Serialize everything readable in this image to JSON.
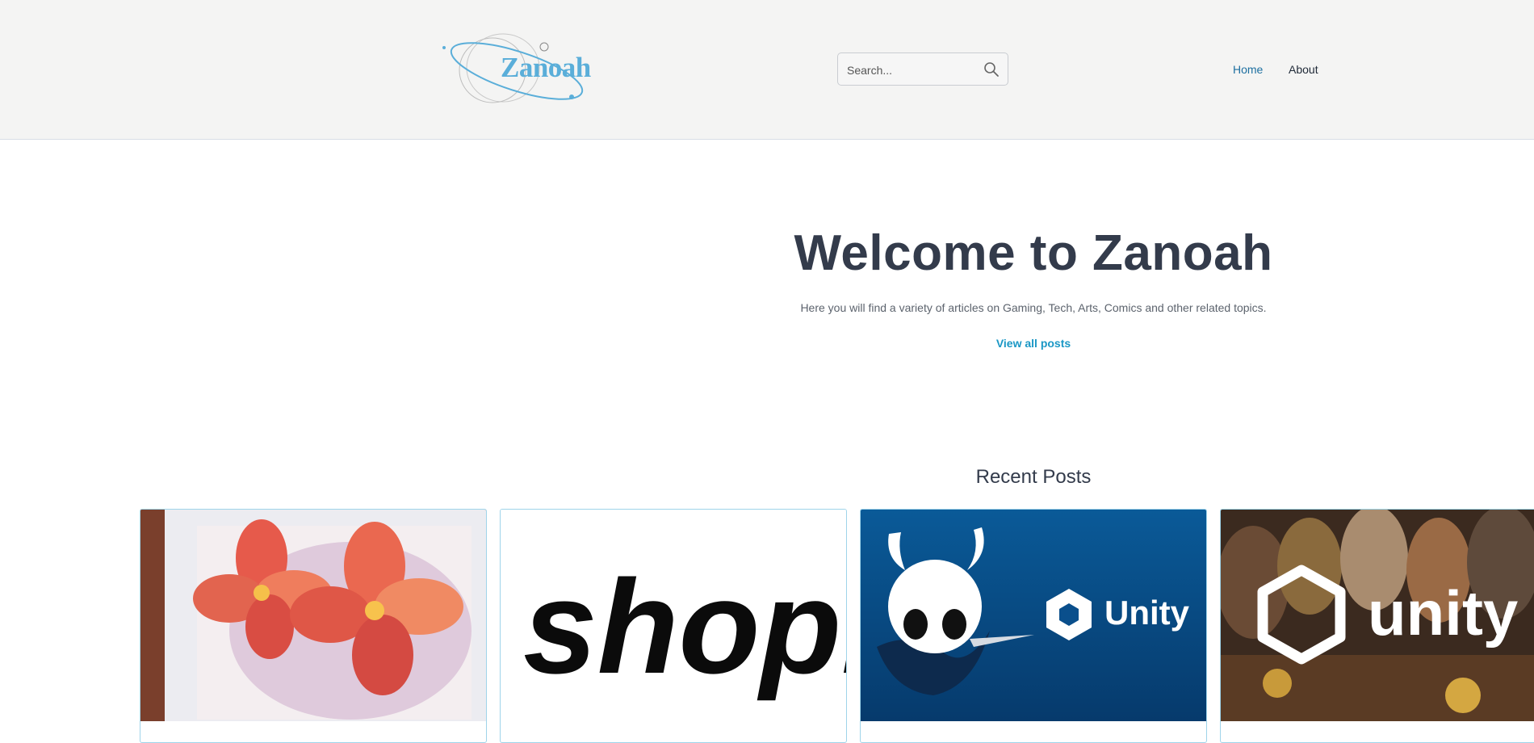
{
  "header": {
    "logo_text": "Zanoah",
    "search": {
      "placeholder": "Search..."
    },
    "nav": {
      "home": "Home",
      "about": "About"
    }
  },
  "hero": {
    "title": "Welcome to Zanoah",
    "subtitle": "Here you will find a variety of articles on Gaming, Tech, Arts, Comics and other related topics.",
    "link": "View all posts"
  },
  "recent": {
    "title": "Recent Posts",
    "cards": [
      {
        "image": "hibiscus-painting"
      },
      {
        "image": "shopify-logo",
        "image_text": "shopi"
      },
      {
        "image": "hollow-knight-unity",
        "image_text": "Unity"
      },
      {
        "image": "dwarves-unity",
        "image_text": "unity"
      }
    ]
  },
  "colors": {
    "header_bg": "#f4f4f3",
    "accent": "#1a97c5",
    "heading": "#333b4b",
    "unity_blue": "#0b4b82"
  }
}
